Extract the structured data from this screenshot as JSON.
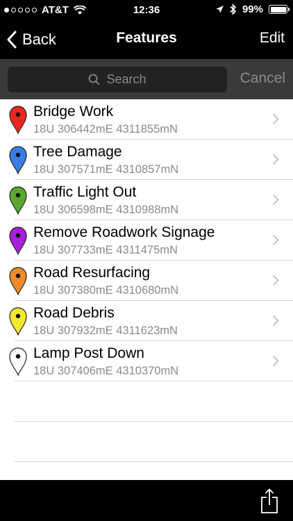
{
  "status_bar": {
    "carrier": "AT&T",
    "time": "12:36",
    "battery": "99%",
    "signal_bars_filled": 1,
    "signal_bars_total": 5,
    "icons": [
      "wifi-icon",
      "location-arrow-icon",
      "bluetooth-icon",
      "battery-icon"
    ]
  },
  "nav": {
    "back_label": "Back",
    "title": "Features",
    "edit_label": "Edit"
  },
  "search": {
    "placeholder": "Search",
    "cancel_label": "Cancel"
  },
  "features": [
    {
      "title": "Bridge Work",
      "coords": "18U 306442mE 4311855mN",
      "pin_color": "#e8281f"
    },
    {
      "title": "Tree Damage",
      "coords": "18U 307571mE 4310857mN",
      "pin_color": "#3a7de5"
    },
    {
      "title": "Traffic Light Out",
      "coords": "18U 306598mE 4310988mN",
      "pin_color": "#5aa832"
    },
    {
      "title": "Remove Roadwork Signage",
      "coords": "18U 307733mE 4311475mN",
      "pin_color": "#a820d8"
    },
    {
      "title": "Road Resurfacing",
      "coords": "18U 307380mE 4310680mN",
      "pin_color": "#ef8a2c"
    },
    {
      "title": "Road Debris",
      "coords": "18U 307932mE 4311623mN",
      "pin_color": "#f3e92c"
    },
    {
      "title": "Lamp Post Down",
      "coords": "18U 307406mE 4310370mN",
      "pin_color": "#ffffff"
    }
  ],
  "toolbar": {
    "share_icon": "share-icon"
  }
}
